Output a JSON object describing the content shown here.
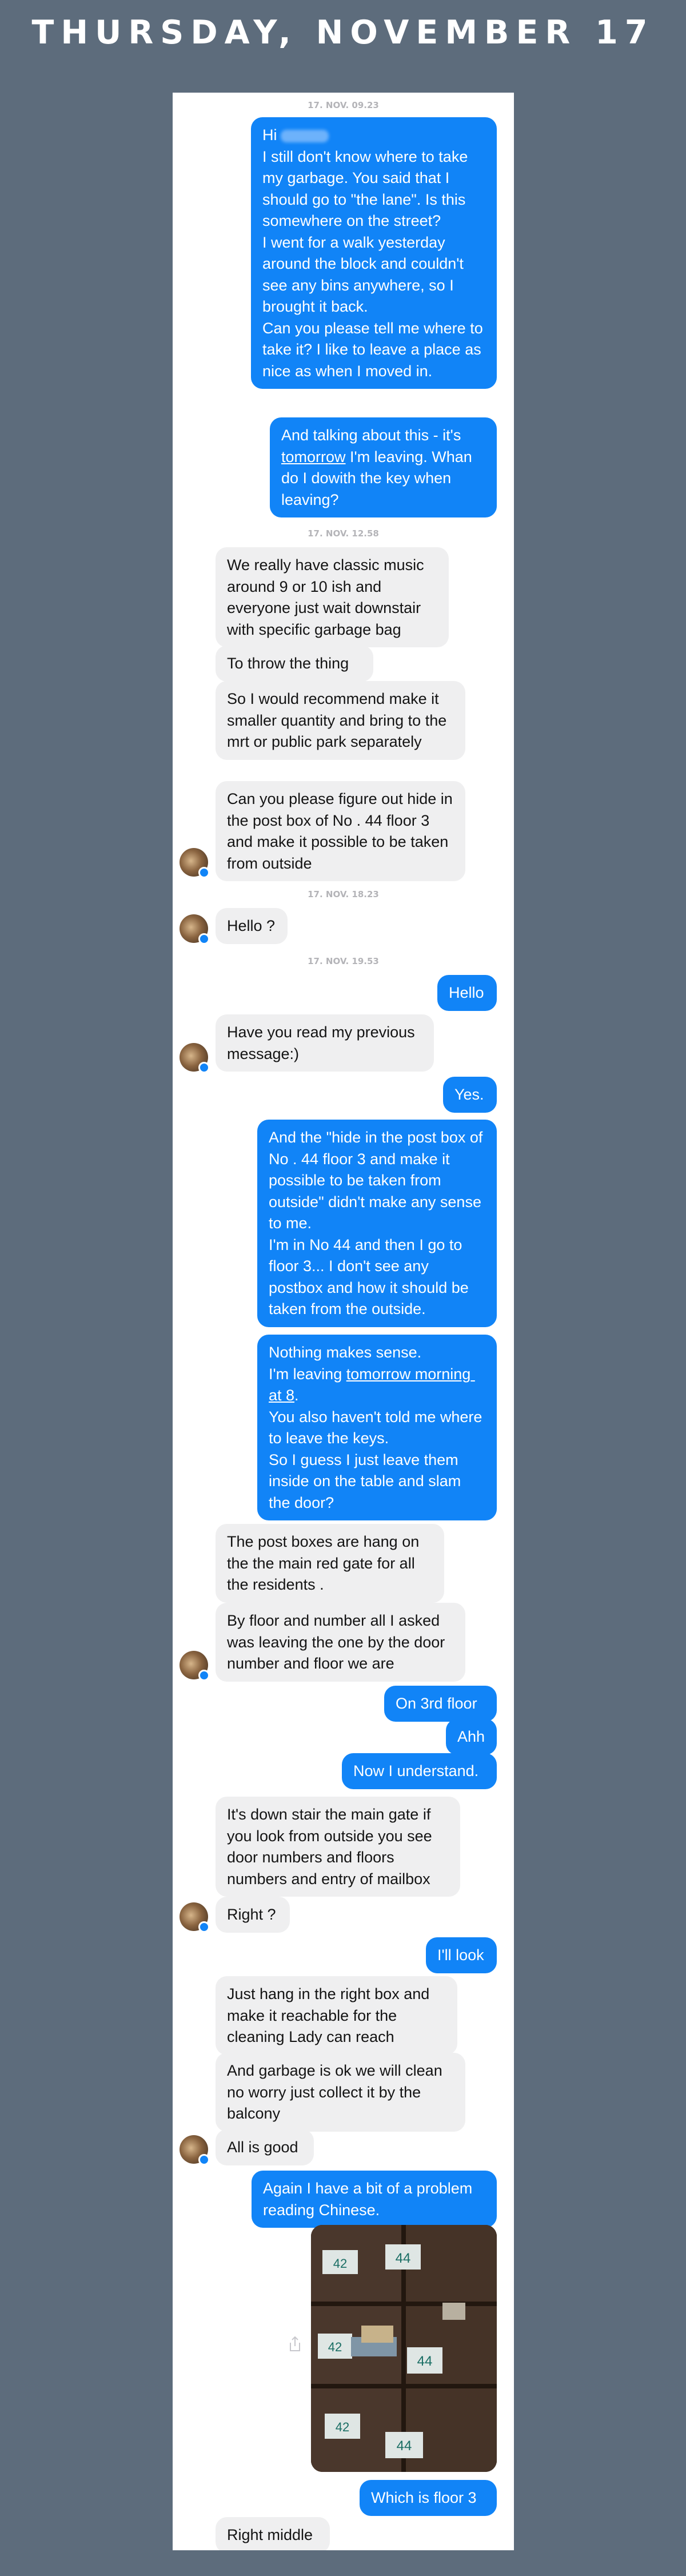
{
  "header": {
    "title": "THURSDAY, NOVEMBER 17"
  },
  "timestamps": [
    "17. NOV. 09.23",
    "17. NOV. 12.58",
    "17. NOV. 18.23",
    "17. NOV. 19.53"
  ],
  "messages": {
    "m1_hi": "Hi",
    "m1_body": "I still don't know where to take my garbage. You said that I should go to \"the lane\". Is this somewhere on the street?\nI went for a walk yesterday around the block and couldn't see any bins anywhere, so I brought it back.\nCan you please tell me where to take it? I like to leave a place as nice as when I moved in.",
    "m2_a": "And talking about this - it's ",
    "m2_link": "tomorrow",
    "m2_b": " I'm leaving. Whan do I dowith the key when leaving?",
    "m3": "We really have classic music around 9 or 10 ish and everyone just wait downstair with specific garbage bag",
    "m4": "To throw the thing",
    "m5": "So I would recommend make it smaller quantity and bring to the mrt or public park separately",
    "m6": "Can you please figure out hide in the post box of No . 44 floor 3 and make it possible to be taken from outside",
    "m7": "Hello ?",
    "m8": "Hello",
    "m9": "Have you read my previous message:)",
    "m10": "Yes.",
    "m11": "And the \"hide in the post box of No . 44 floor 3 and make it possible to be taken from outside\" didn't make any sense to me.\nI'm in No 44 and then I go to floor 3... I don't see any postbox and how it should be taken from the outside.",
    "m12_a": "Nothing makes sense.\nI'm leaving ",
    "m12_link": "tomorrow morning at 8",
    "m12_b": ".\nYou also haven't told me where to leave the keys.\nSo I guess I just leave them inside on the table and slam the door?",
    "m13": "The post boxes are hang on the the main red gate for all the residents .",
    "m14": "By floor and number all I asked was leaving the one by the door number and floor we are",
    "m15": "On 3rd floor",
    "m16": "Ahh",
    "m17": "Now I understand.",
    "m18": "It's down stair the main gate if you look from outside you see door numbers and floors numbers and entry of mailbox",
    "m19": "Right ?",
    "m20": "I'll look",
    "m21": "Just hang in the right box and make it reachable for the cleaning Lady can reach",
    "m22": "And garbage is ok we will clean no worry just collect it by the balcony",
    "m23": "All is good",
    "m24": "Again I have a bit of a problem reading Chinese.",
    "m25": "Which is floor 3",
    "m26": "Right middle"
  },
  "photo": {
    "labels": [
      "42",
      "44",
      "42",
      "44",
      "42",
      "44"
    ]
  },
  "icons": {
    "avatar": "avatar-photo",
    "share": "share-icon",
    "badge": "messenger-badge"
  },
  "colors": {
    "outgoing": "#1184f7",
    "incoming": "#efeff0",
    "background": "#5d6c7c"
  }
}
